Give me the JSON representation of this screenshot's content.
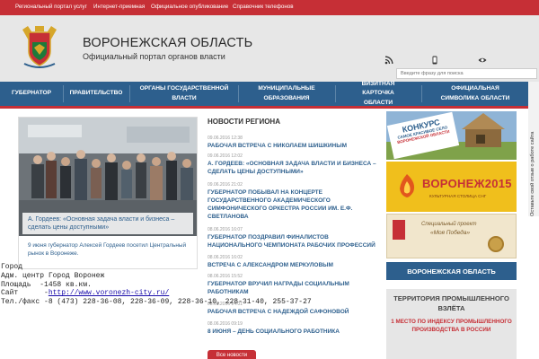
{
  "topbar": {
    "links": [
      {
        "label": "Региональный портал услуг"
      },
      {
        "label": "Интернет-приемная"
      },
      {
        "label": "Официальное опубликование"
      },
      {
        "label": "Справочник телефонов"
      }
    ]
  },
  "header": {
    "title": "ВОРОНЕЖСКАЯ ОБЛАСТЬ",
    "subtitle": "Официальный портал органов власти",
    "search_placeholder": "Введите фразу для поиска"
  },
  "nav": {
    "items": [
      {
        "label": "ГУБЕРНАТОР"
      },
      {
        "label": "ПРАВИТЕЛЬСТВО"
      },
      {
        "label": "ОРГАНЫ ГОСУДАРСТВЕННОЙ ВЛАСТИ"
      },
      {
        "label": "МУНИЦИПАЛЬНЫЕ ОБРАЗОВАНИЯ"
      },
      {
        "label": "ВИЗИТНАЯ КАРТОЧКА ОБЛАСТИ"
      },
      {
        "label": "ОФИЦИАЛЬНАЯ СИМВОЛИКА ОБЛАСТИ"
      }
    ]
  },
  "featured": {
    "caption": "А. Гордеев: «Основная задача власти и бизнеса – сделать цены доступными»",
    "text": "9 июня губернатор Алексей Гордеев посетил Центральный рынок в Воронеже."
  },
  "news": {
    "heading": "НОВОСТИ РЕГИОНА",
    "items": [
      {
        "date": "09.06.2016 12:38",
        "title": "РАБОЧАЯ ВСТРЕЧА С НИКОЛАЕМ ШИШКИНЫМ"
      },
      {
        "date": "09.06.2016 12:02",
        "title": "А. ГОРДЕЕВ: «ОСНОВНАЯ ЗАДАЧА ВЛАСТИ И БИЗНЕСА – СДЕЛАТЬ ЦЕНЫ ДОСТУПНЫМИ»"
      },
      {
        "date": "09.06.2016 21:02",
        "title": "ГУБЕРНАТОР ПОБЫВАЛ НА КОНЦЕРТЕ ГОСУДАРСТВЕННОГО АКАДЕМИЧЕСКОГО СИМФОНИЧЕСКОГО ОРКЕСТРА РОССИИ ИМ. Е.Ф. СВЕТЛАНОВА"
      },
      {
        "date": "08.06.2016 16:07",
        "title": "ГУБЕРНАТОР ПОЗДРАВИЛ ФИНАЛИСТОВ НАЦИОНАЛЬНОГО ЧЕМПИОНАТА РАБОЧИХ ПРОФЕССИЙ"
      },
      {
        "date": "08.06.2016 16:02",
        "title": "ВСТРЕЧА С АЛЕКСАНДРОМ МЕРКУЛОВЫМ"
      },
      {
        "date": "08.06.2016 15:52",
        "title": "ГУБЕРНАТОР ВРУЧИЛ НАГРАДЫ СОЦИАЛЬНЫМ РАБОТНИКАМ"
      },
      {
        "date": "08.06.2016 14:01",
        "title": "РАБОЧАЯ ВСТРЕЧА С НАДЕЖДОЙ САФОНОВОЙ"
      },
      {
        "date": "08.06.2016 09:19",
        "title": "8 ИЮНЯ – ДЕНЬ СОЦИАЛЬНОГО РАБОТНИКА"
      }
    ],
    "all_label": "Все новости"
  },
  "banners": {
    "contest_lines": [
      "КОНКУРС",
      "САМОЕ КРАСИВОЕ СЕЛО",
      "ВОРОНЕЖСКОЙ ОБЛАСТИ"
    ],
    "capital_title": "ВОРОНЕЖ2015",
    "capital_sub": "КУЛЬТУРНАЯ СТОЛИЦА СНГ",
    "project_lines": [
      "Специальный проект",
      "«Моя Победа»"
    ],
    "region_label": "ВОРОНЕЖСКАЯ ОБЛАСТЬ",
    "industrial_title": "ТЕРРИТОРИЯ ПРОМЫШЛЕННОГО ВЗЛЁТА",
    "industrial_sub": "1 МЕСТО ПО ИНДЕКСУ ПРОМЫШЛЕННОГО ПРОИЗВОДСТВА В РОССИИ"
  },
  "side_tab": {
    "label": "Оставьте свой отзыв о работе сайта"
  },
  "overlay": {
    "lines": [
      {
        "label": "Город",
        "value": ""
      },
      {
        "label": "Адм. центр",
        "value": "Город Воронеж"
      },
      {
        "label": "Площадь",
        "value": "-1458 кв.км."
      },
      {
        "label": "Сайт",
        "value": "-",
        "link": "http://www.voronezh-city.ru/"
      },
      {
        "label": "Тел./факс",
        "value": "-8 (473) 228-36-08, 228-36-09, 228-36-10, 228-31-40, 255-37-27"
      }
    ]
  },
  "colors": {
    "topbar": "#c62f36",
    "nav": "#2d5f8d",
    "accent_link": "#2d5f8d",
    "accent_red": "#c62f36"
  }
}
